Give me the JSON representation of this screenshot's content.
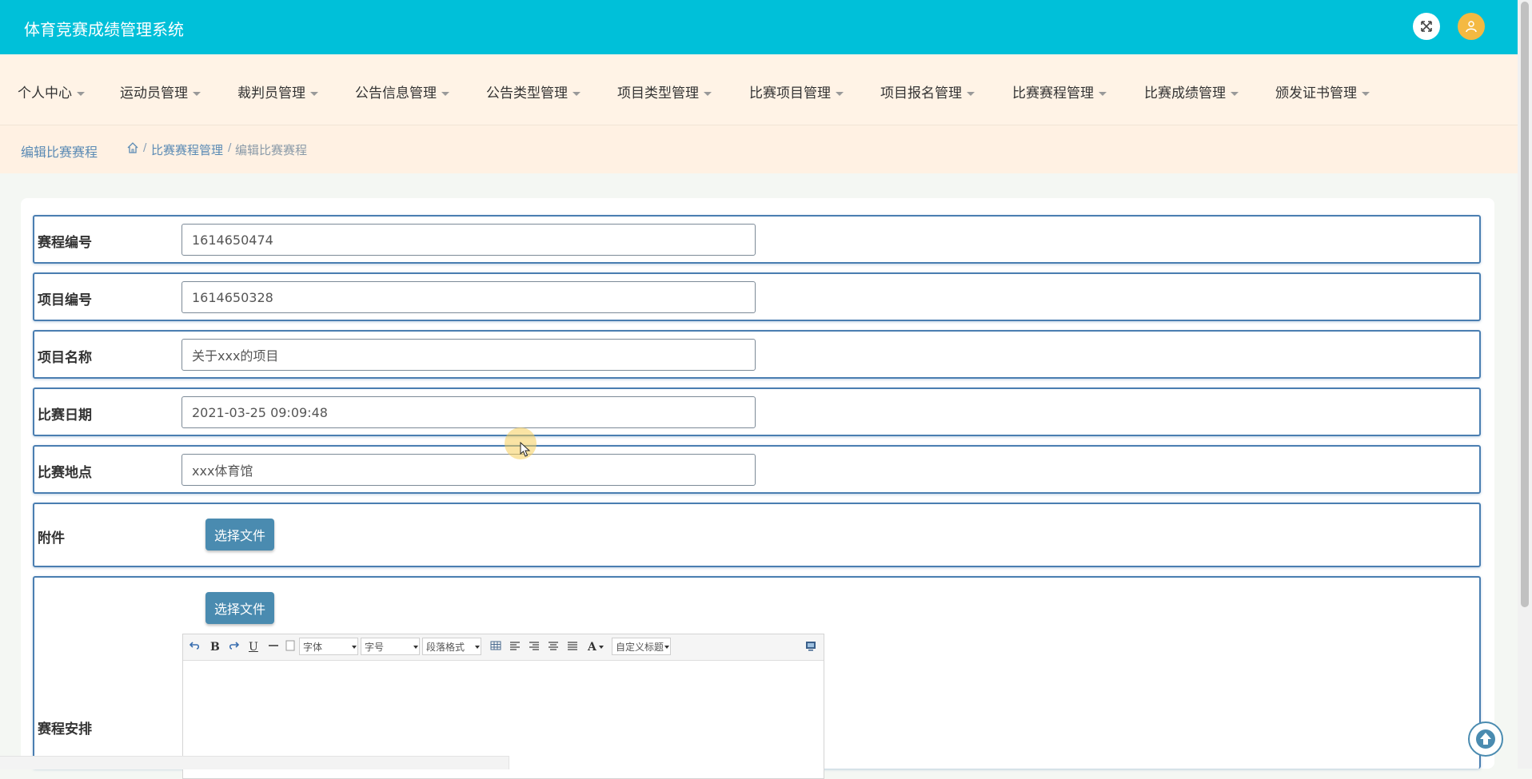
{
  "app": {
    "title": "体育竞赛成绩管理系统"
  },
  "header_icons": [
    "fullscreen-icon",
    "user-avatar-icon"
  ],
  "nav": {
    "items": [
      "个人中心",
      "运动员管理",
      "裁判员管理",
      "公告信息管理",
      "公告类型管理",
      "项目类型管理",
      "比赛项目管理",
      "项目报名管理",
      "比赛赛程管理",
      "比赛成绩管理",
      "颁发证书管理"
    ]
  },
  "breadcrumb": {
    "title": "编辑比赛赛程",
    "separator": "/",
    "parent": "比赛赛程管理",
    "current": "编辑比赛赛程"
  },
  "form": {
    "schedule_no": {
      "label": "赛程编号",
      "value": "1614650474"
    },
    "project_no": {
      "label": "项目编号",
      "value": "1614650328"
    },
    "project_name": {
      "label": "项目名称",
      "value": "关于xxx的项目"
    },
    "match_date": {
      "label": "比赛日期",
      "value": "2021-03-25 09:09:48"
    },
    "match_place": {
      "label": "比赛地点",
      "value": "xxx体育馆"
    },
    "attachment": {
      "label": "附件",
      "button": "选择文件"
    },
    "arrangement": {
      "label": "赛程安排",
      "button": "选择文件"
    }
  },
  "editor_toolbar": {
    "bold": "B",
    "underline": "U",
    "font_family": "字体",
    "font_size": "字号",
    "paragraph": "段落格式",
    "font_color": "A",
    "custom_title": "自定义标题"
  },
  "colors": {
    "header": "#00c0d9",
    "nav_bg": "#fff3e6",
    "row_border": "#4a7eb1",
    "button": "#4a8bb0"
  }
}
